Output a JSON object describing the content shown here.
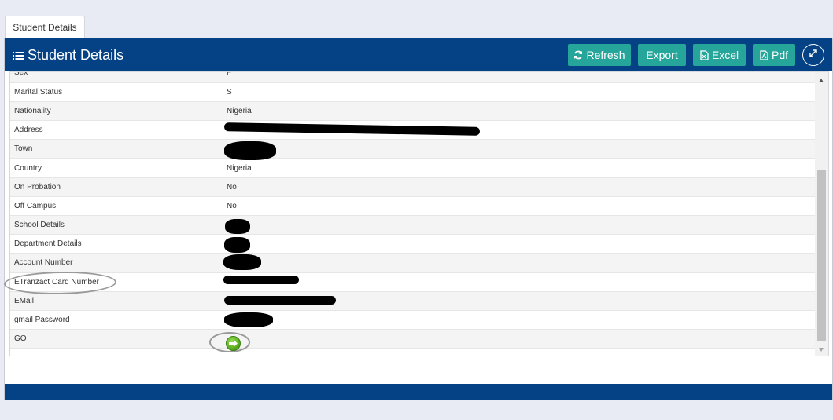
{
  "tab": {
    "label": "Student Details"
  },
  "header": {
    "title": "Student Details",
    "buttons": {
      "refresh": "Refresh",
      "export": "Export",
      "excel": "Excel",
      "pdf": "Pdf"
    }
  },
  "rows": [
    {
      "label": "Sex",
      "value": "F"
    },
    {
      "label": "Marital Status",
      "value": "S"
    },
    {
      "label": "Nationality",
      "value": "Nigeria"
    },
    {
      "label": "Address",
      "value": ""
    },
    {
      "label": "Town",
      "value": ""
    },
    {
      "label": "Country",
      "value": "Nigeria"
    },
    {
      "label": "On Probation",
      "value": "No"
    },
    {
      "label": "Off Campus",
      "value": "No"
    },
    {
      "label": "School Details",
      "value": ""
    },
    {
      "label": "Department Details",
      "value": ""
    },
    {
      "label": "Account Number",
      "value": ""
    },
    {
      "label": "ETranzact Card Number",
      "value": ""
    },
    {
      "label": "EMail",
      "value": ""
    },
    {
      "label": "gmail Password",
      "value": ""
    },
    {
      "label": "GO",
      "value": ""
    }
  ],
  "colors": {
    "header": "#044285",
    "button": "#26a69a",
    "go": "#5aad1e"
  }
}
